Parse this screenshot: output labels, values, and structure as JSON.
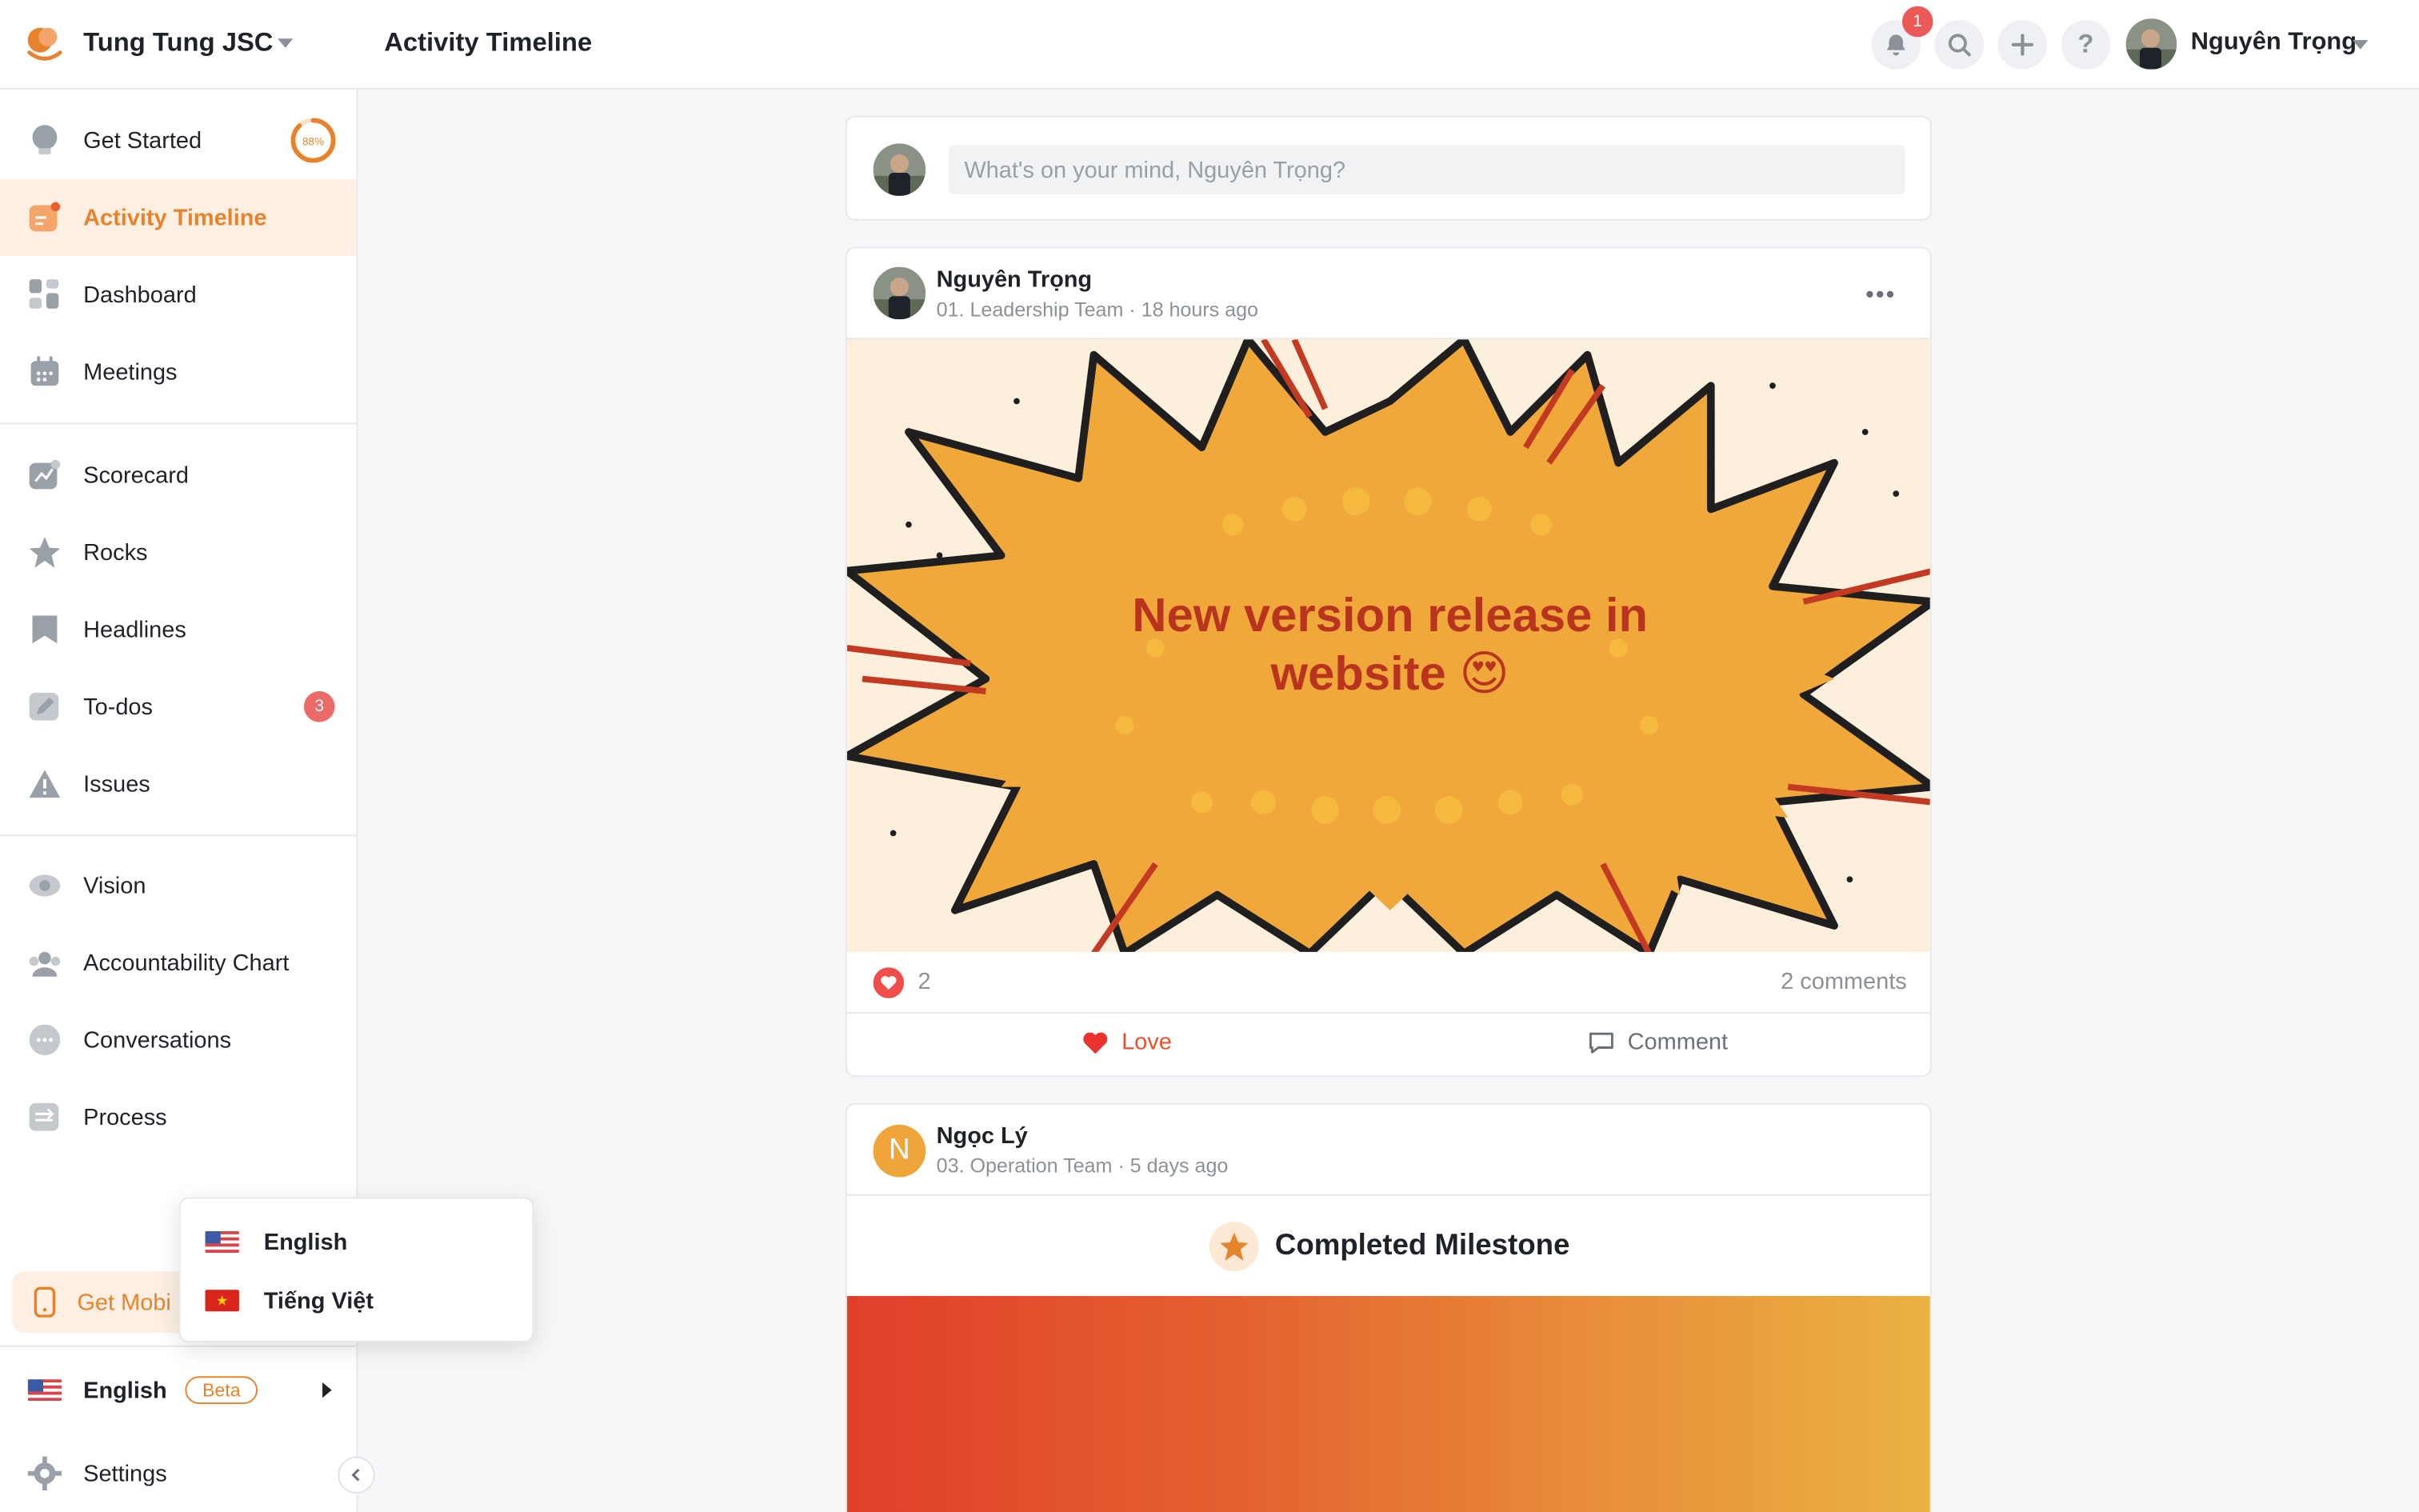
{
  "header": {
    "org_name": "Tung Tung JSC",
    "page_title": "Activity Timeline",
    "notification_count": "1",
    "user_name": "Nguyên Trọng"
  },
  "sidebar": {
    "progress": {
      "percent": 88,
      "label": "88%"
    },
    "items": [
      {
        "label": "Get Started",
        "icon": "lightbulb-icon"
      },
      {
        "label": "Activity Timeline",
        "icon": "timeline-icon",
        "active": true
      },
      {
        "label": "Dashboard",
        "icon": "grid-icon"
      },
      {
        "label": "Meetings",
        "icon": "calendar-icon"
      },
      {
        "label": "Scorecard",
        "icon": "chart-icon"
      },
      {
        "label": "Rocks",
        "icon": "star-icon"
      },
      {
        "label": "Headlines",
        "icon": "bookmark-icon"
      },
      {
        "label": "To-dos",
        "icon": "pencil-icon",
        "badge": "3"
      },
      {
        "label": "Issues",
        "icon": "warning-icon"
      },
      {
        "label": "Vision",
        "icon": "eye-icon"
      },
      {
        "label": "Accountability Chart",
        "icon": "people-icon"
      },
      {
        "label": "Conversations",
        "icon": "chat-icon"
      },
      {
        "label": "Process",
        "icon": "process-icon"
      }
    ],
    "mobile_label": "Get Mobi",
    "language": {
      "label": "English",
      "beta": "Beta"
    },
    "settings_label": "Settings"
  },
  "lang_menu": {
    "options": [
      {
        "label": "English",
        "flag": "us-flag-icon"
      },
      {
        "label": "Tiếng Việt",
        "flag": "vn-flag-icon"
      }
    ]
  },
  "feed": {
    "compose_placeholder": "What's on your mind, Nguyên Trọng?",
    "posts": [
      {
        "author": "Nguyên Trọng",
        "meta": "01. Leadership Team · 18 hours ago",
        "image_text_line1": "New version release in",
        "image_text_line2": "website 😍",
        "reactions": "2",
        "comments": "2 comments",
        "love_label": "Love",
        "comment_label": "Comment"
      },
      {
        "author": "Ngọc Lý",
        "avatar_letter": "N",
        "meta": "03. Operation Team · 5 days ago",
        "milestone": "Completed Milestone"
      }
    ]
  },
  "colors": {
    "accent": "#e8832d",
    "active_bg": "#fdf0e3",
    "badge": "#ec6a67",
    "heart": "#ef4e4b"
  }
}
